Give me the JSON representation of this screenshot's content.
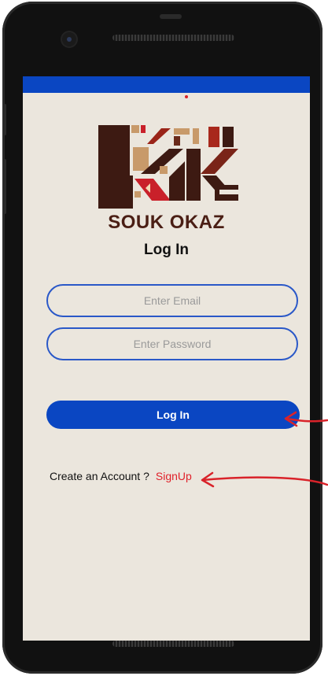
{
  "app": {
    "brand_name": "SOUK OKAZ",
    "page_title": "Log In"
  },
  "login_form": {
    "email_placeholder": "Enter Email",
    "password_placeholder": "Enter Password",
    "login_button_label": "Log In"
  },
  "signup": {
    "prompt": "Create an Account ?",
    "link_label": "SignUp"
  },
  "colors": {
    "accent": "#0a46c2",
    "screen_background": "#ebe6dd",
    "brand_text": "#4a1e14",
    "link": "#e0212a",
    "annotation_arrow": "#d9232a"
  },
  "icons": {
    "logo": "souk-okaz-logo-icon",
    "camera": "front-camera-icon",
    "annotation": "red-arrow-icon"
  }
}
